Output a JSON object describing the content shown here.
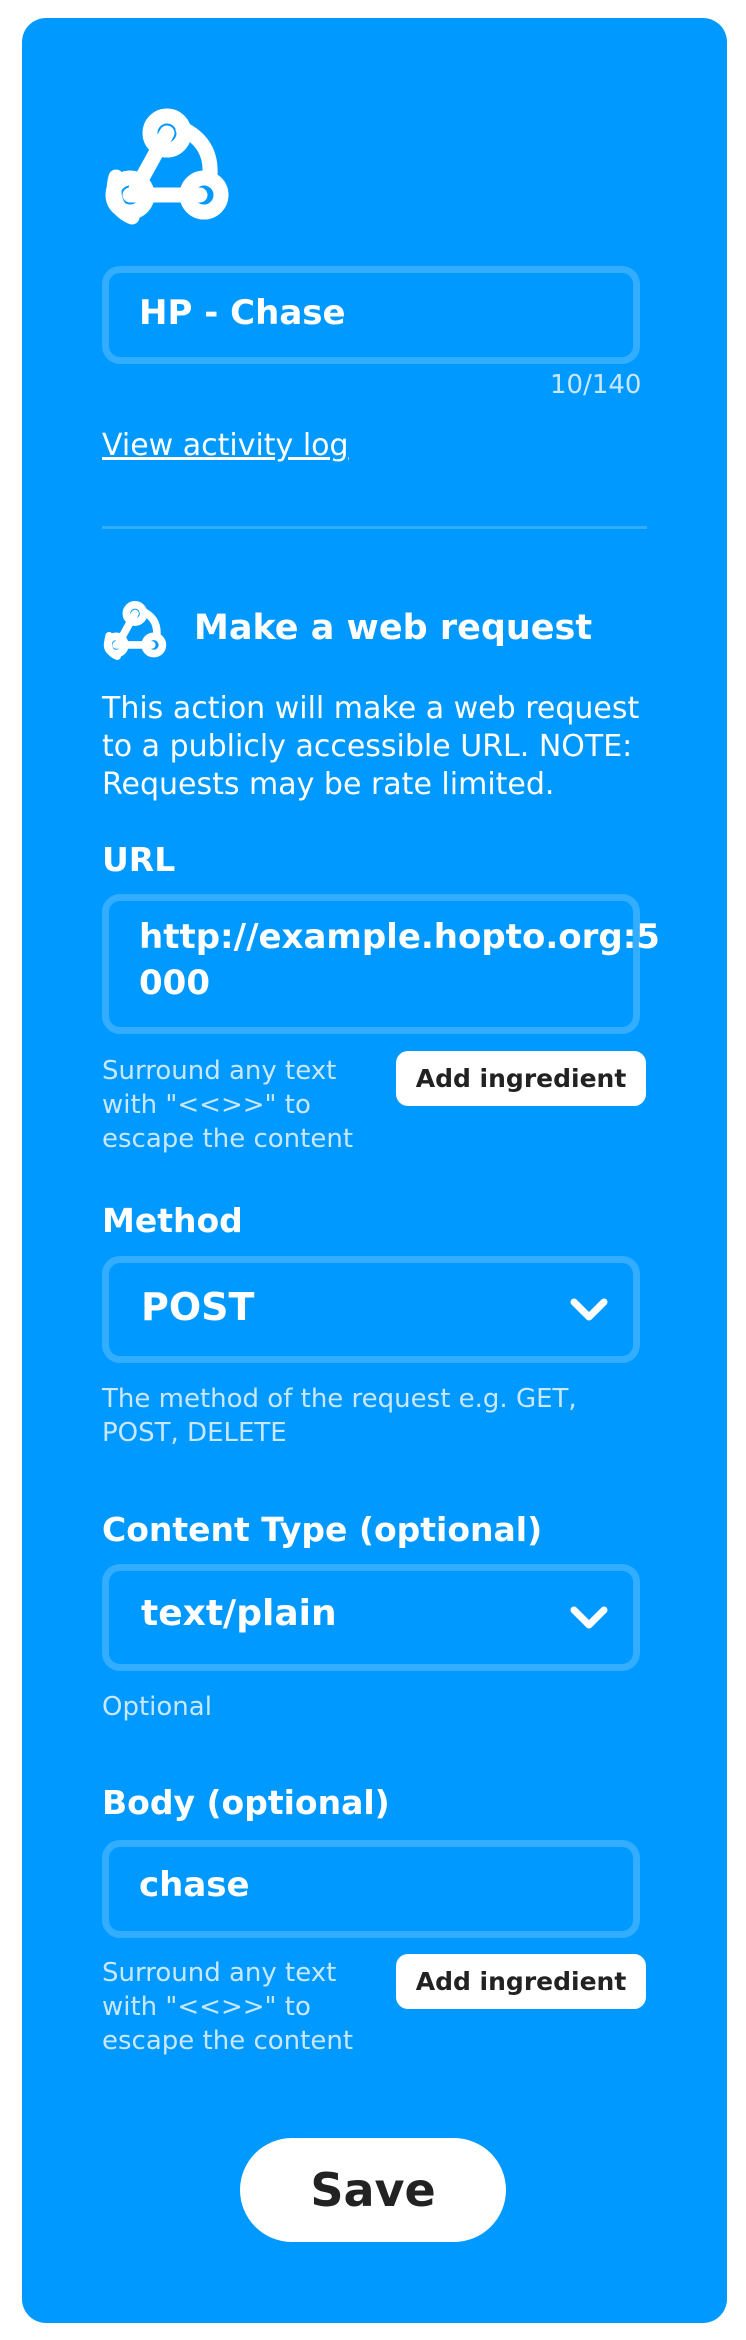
{
  "applet": {
    "name": "HP - Chase",
    "char_count": "10/140",
    "activity_link": "View activity log"
  },
  "action": {
    "title": "Make a web request",
    "description": "This action will make a web request to a publicly accessible URL. NOTE: Requests may be rate limited."
  },
  "fields": {
    "url": {
      "label": "URL",
      "line1": "http://example.hopto.org:5",
      "line2": "000",
      "help": [
        "Surround any text",
        "with \"<<>>\" to",
        "escape the content"
      ],
      "ingredient_label": "Add ingredient"
    },
    "method": {
      "label": "Method",
      "value": "POST",
      "help": [
        "The method of the request e.g. GET,",
        "POST, DELETE"
      ]
    },
    "content_type": {
      "label": "Content Type (optional)",
      "value": "text/plain",
      "help": "Optional"
    },
    "body": {
      "label": "Body (optional)",
      "value": "chase",
      "help": [
        "Surround any text",
        "with \"<<>>\" to",
        "escape the content"
      ],
      "ingredient_label": "Add ingredient"
    }
  },
  "save_label": "Save",
  "colors": {
    "card": "#0099ff",
    "field_border": "#33adff",
    "divider": "#33adff",
    "button_bg": "#ffffff",
    "button_text": "#222222"
  },
  "icons": {
    "service": "webhook-icon",
    "action": "webhook-icon",
    "dropdown": "chevron-down-icon"
  }
}
